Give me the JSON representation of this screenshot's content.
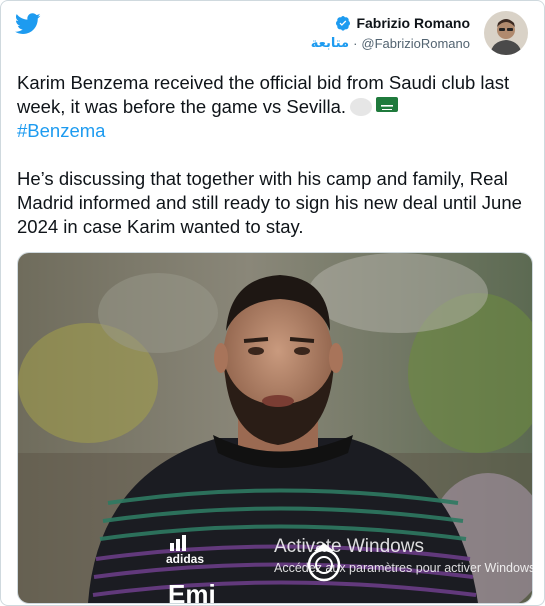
{
  "header": {
    "display_name": "Fabrizio Romano",
    "follow_label": "متابعة",
    "separator": "·",
    "handle": "@FabrizioRomano"
  },
  "icons": {
    "logo": "twitter-bird-icon",
    "verified": "verified-badge-icon",
    "flag_1": "white-flag-emoji",
    "flag_2": "saudi-arabia-flag-emoji"
  },
  "tweet": {
    "paragraph_1": "Karim Benzema received the official bid from Saudi club last week, it was before the game vs Sevilla.",
    "hashtag": "#Benzema",
    "paragraph_2": "He’s discussing that together with his camp and family, Real Madrid informed and still ready to sign his new deal until June 2024 in case Karim wanted to stay."
  },
  "media": {
    "alt": "Photo of Karim Benzema in Real Madrid training top",
    "shirt_brand": "adidas",
    "shirt_sponsor_partial": "Emi"
  },
  "watermark": {
    "title": "Activate Windows",
    "subtitle": "Accédez aux paramètres pour activer Windows."
  },
  "colors": {
    "accent": "#1d9bf0",
    "text": "#0f1419",
    "secondary": "#536471"
  }
}
